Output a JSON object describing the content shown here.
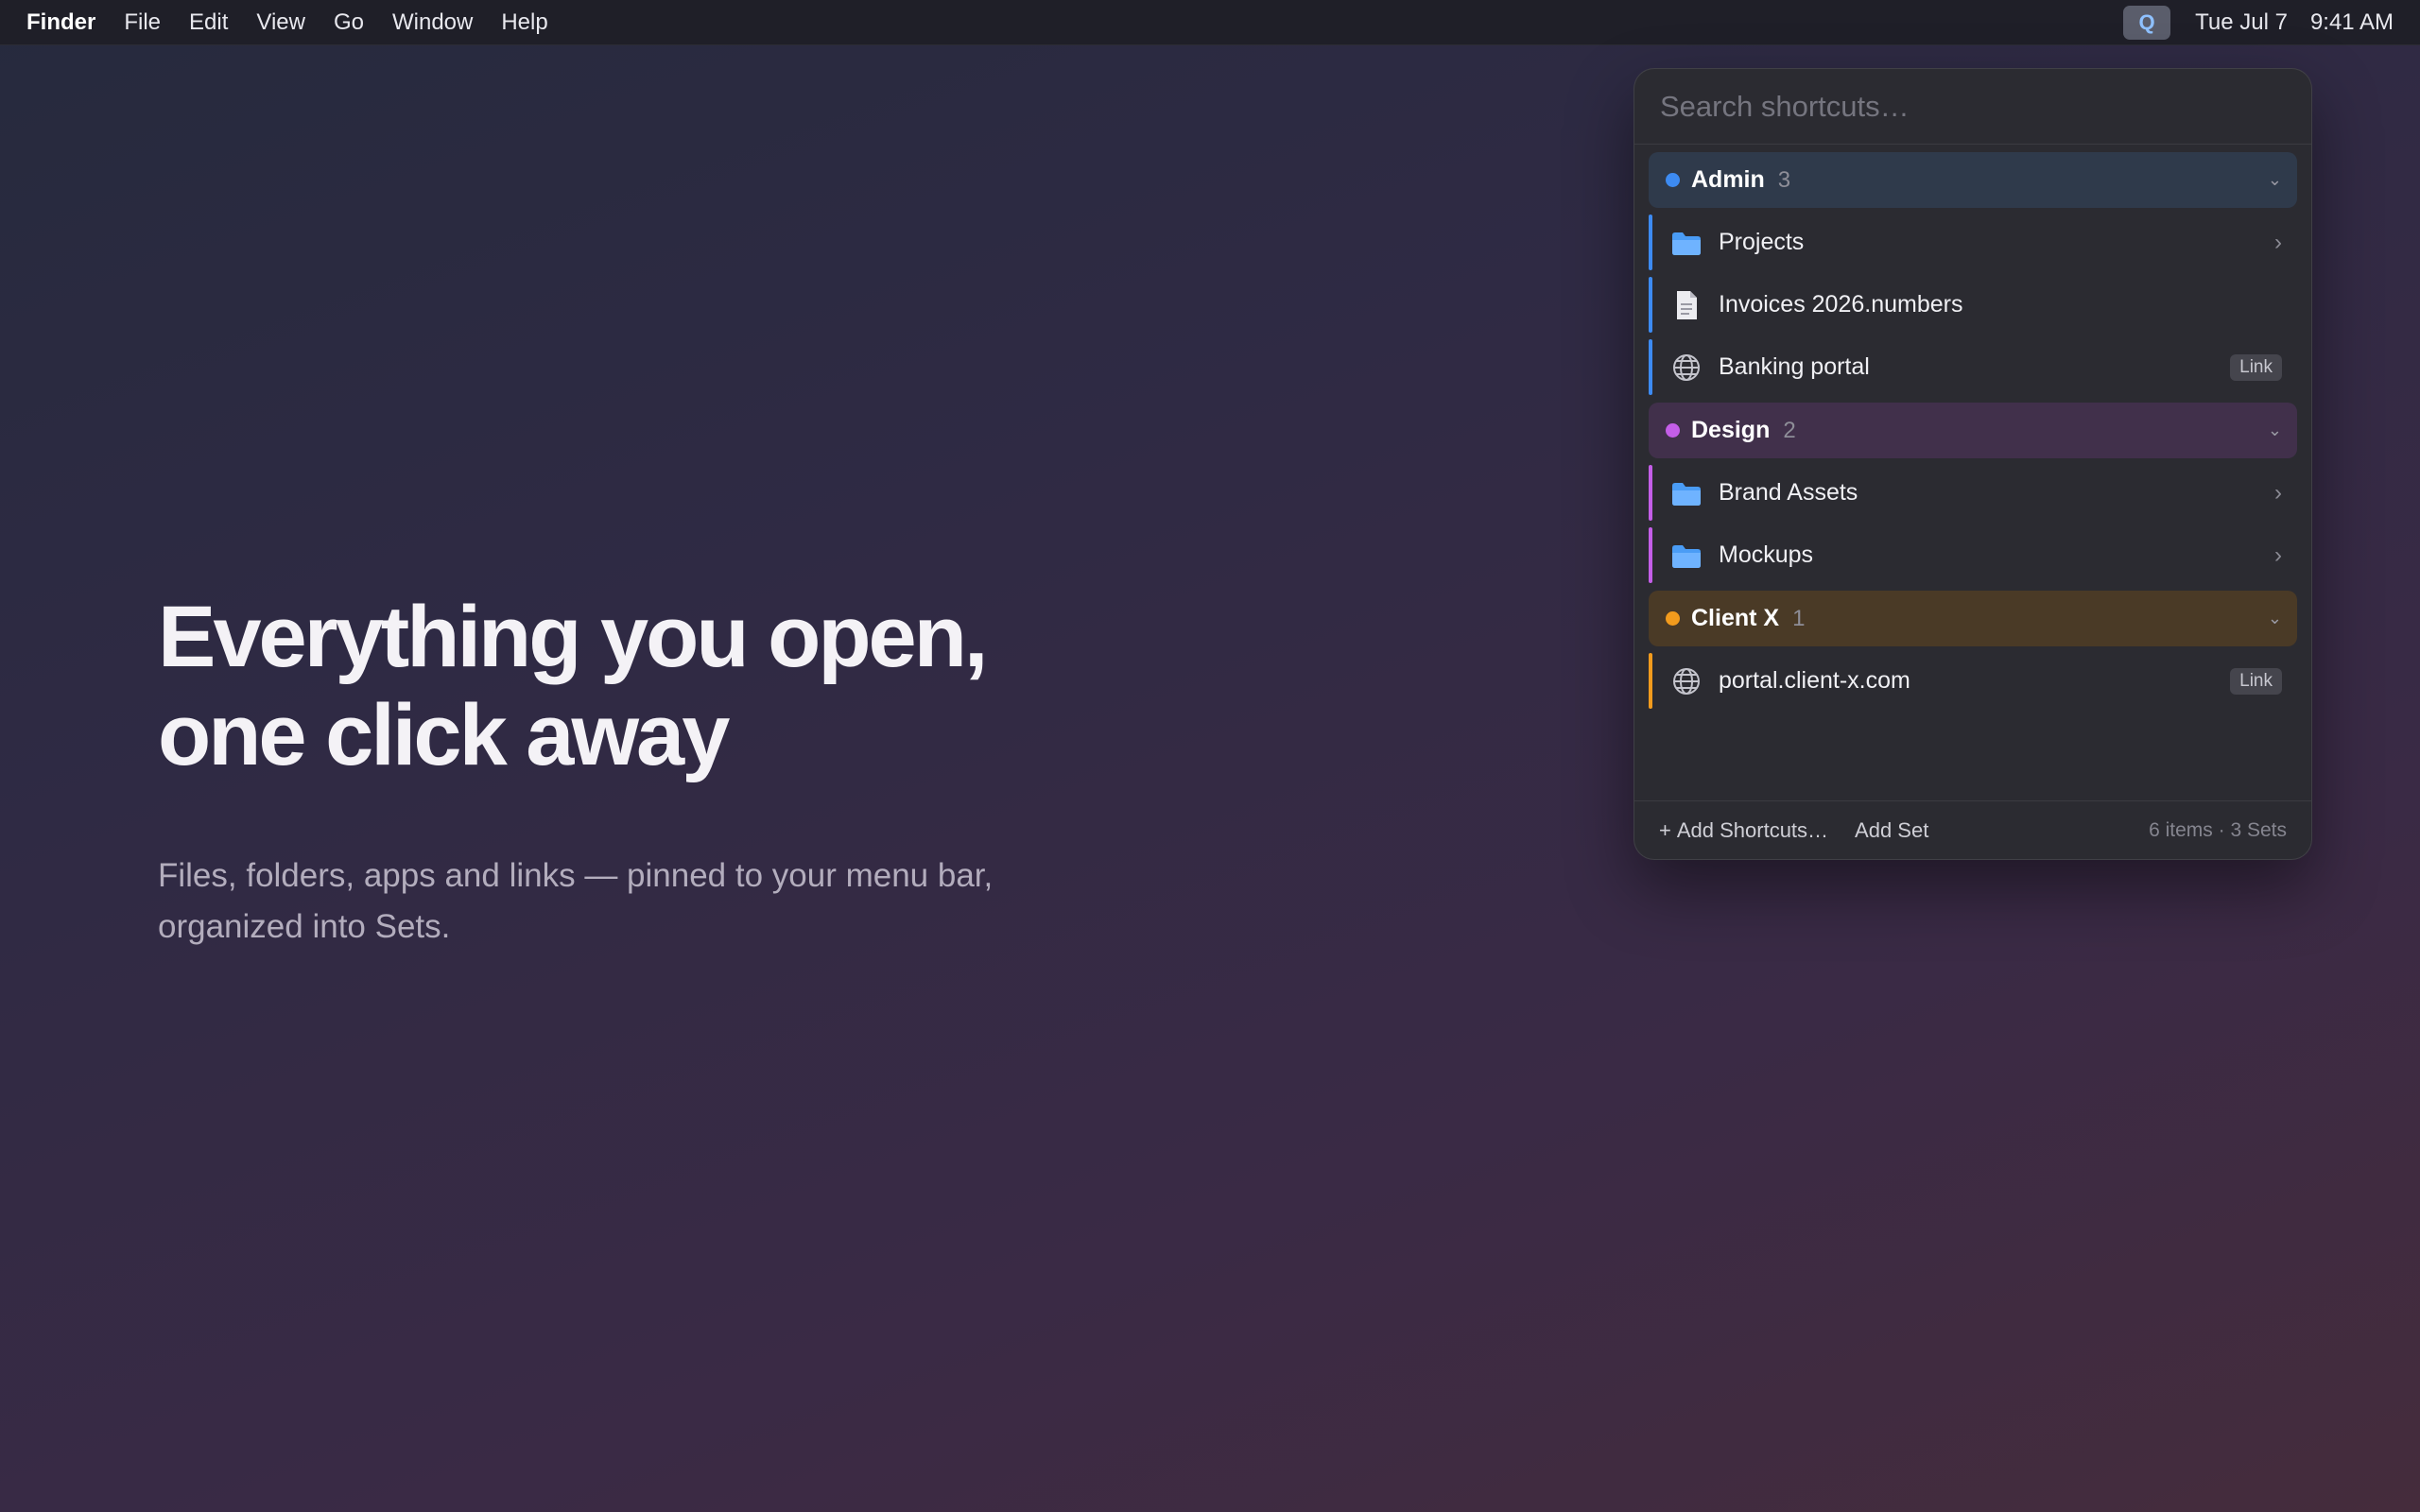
{
  "menubar": {
    "app_name": "Finder",
    "menus": [
      "File",
      "Edit",
      "View",
      "Go",
      "Window",
      "Help"
    ],
    "tray_icon_letter": "Q",
    "date": "Tue Jul 7",
    "time": "9:41 AM"
  },
  "hero": {
    "headline_line1": "Everything you open,",
    "headline_line2": "one click away",
    "subtitle_line1": "Files, folders, apps and links — pinned to your menu bar,",
    "subtitle_line2": "organized into Sets."
  },
  "panel": {
    "search_placeholder": "Search shortcuts…",
    "sets": [
      {
        "name": "Admin",
        "count": "3",
        "color": "#3d8bf2",
        "header_bg": "#2f3a4b",
        "items": [
          {
            "label": "Projects",
            "icon": "folder-icon",
            "trailing": "chevron"
          },
          {
            "label": "Invoices 2026.numbers",
            "icon": "document-icon",
            "trailing": ""
          },
          {
            "label": "Banking portal",
            "icon": "globe-icon",
            "trailing": "Link"
          }
        ]
      },
      {
        "name": "Design",
        "count": "2",
        "color": "#c45ee8",
        "header_bg": "#41304b",
        "items": [
          {
            "label": "Brand Assets",
            "icon": "folder-icon",
            "trailing": "chevron"
          },
          {
            "label": "Mockups",
            "icon": "folder-icon",
            "trailing": "chevron"
          }
        ]
      },
      {
        "name": "Client X",
        "count": "1",
        "color": "#f29b1d",
        "header_bg": "#4a3a26",
        "items": [
          {
            "label": "portal.client-x.com",
            "icon": "globe-icon",
            "trailing": "Link"
          }
        ]
      }
    ],
    "footer": {
      "add_shortcuts": "Add Shortcuts…",
      "add_set": "Add Set",
      "status": "6 items · 3 Sets"
    }
  }
}
